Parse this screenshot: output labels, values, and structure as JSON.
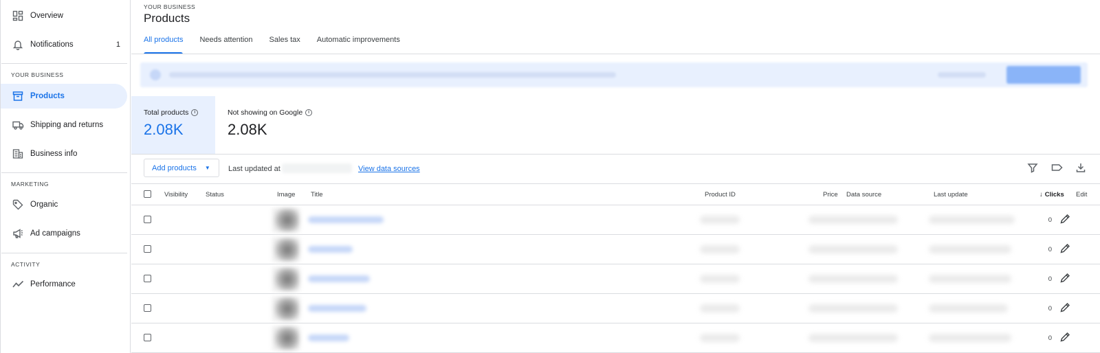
{
  "sidebar": {
    "items": [
      {
        "label": "Overview",
        "icon": "dashboard-icon"
      },
      {
        "label": "Notifications",
        "icon": "bell-icon",
        "badge": "1"
      },
      {
        "label": "Products",
        "icon": "archive-box-icon",
        "active": true
      },
      {
        "label": "Shipping and returns",
        "icon": "truck-icon"
      },
      {
        "label": "Business info",
        "icon": "building-icon"
      },
      {
        "label": "Organic",
        "icon": "tag-icon"
      },
      {
        "label": "Ad campaigns",
        "icon": "megaphone-icon"
      },
      {
        "label": "Performance",
        "icon": "trend-line-icon"
      }
    ],
    "sections": {
      "business": "YOUR BUSINESS",
      "marketing": "MARKETING",
      "activity": "ACTIVITY"
    }
  },
  "header": {
    "breadcrumb": "YOUR BUSINESS",
    "title": "Products",
    "tabs": [
      {
        "label": "All products",
        "active": true
      },
      {
        "label": "Needs attention"
      },
      {
        "label": "Sales tax"
      },
      {
        "label": "Automatic improvements"
      }
    ]
  },
  "stats": {
    "total": {
      "label": "Total products",
      "value": "2.08K"
    },
    "not_showing": {
      "label": "Not showing on Google",
      "value": "2.08K"
    }
  },
  "toolbar": {
    "add_label": "Add products",
    "last_updated": "Last updated at",
    "view_sources": "View data sources"
  },
  "table": {
    "columns": {
      "visibility": "Visibility",
      "status": "Status",
      "image": "Image",
      "title": "Title",
      "product_id": "Product ID",
      "price": "Price",
      "data_source": "Data source",
      "last_update": "Last update",
      "clicks": "Clicks",
      "edit": "Edit"
    },
    "rows": [
      {
        "clicks": "0"
      },
      {
        "clicks": "0"
      },
      {
        "clicks": "0"
      },
      {
        "clicks": "0"
      },
      {
        "clicks": "0"
      }
    ]
  },
  "colors": {
    "accent": "#1a73e8",
    "selected_bg": "#e8f0fe",
    "divider": "#dadce0"
  }
}
